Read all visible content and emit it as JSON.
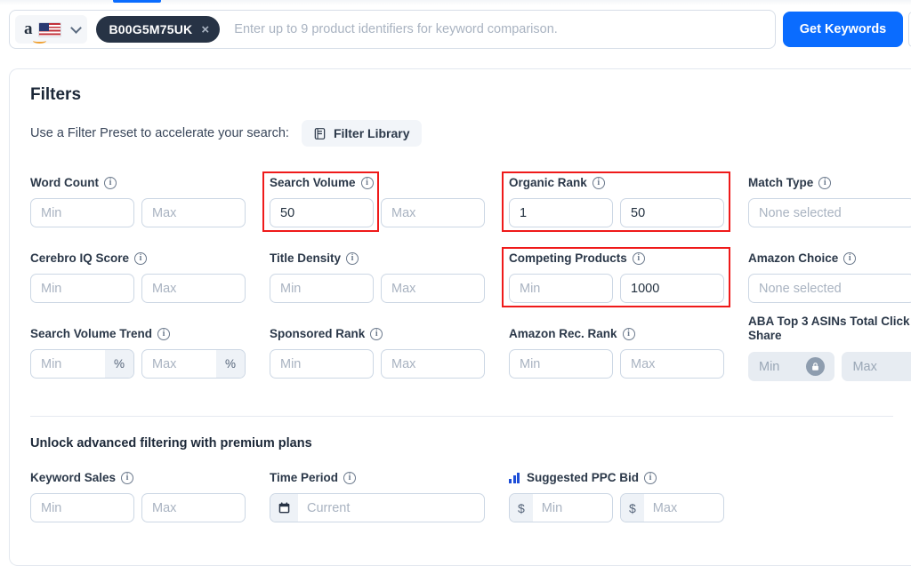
{
  "topbar": {
    "marketplace": {
      "name": "amazon-us-marketplace",
      "store_glyph": "a"
    },
    "asin_chip": {
      "label": "B00G5M75UK",
      "remove": "×"
    },
    "search_placeholder": "Enter up to 9 product identifiers for keyword comparison.",
    "search_value": "",
    "get_keywords_label": "Get Keywords"
  },
  "card": {
    "title": "Filters",
    "preset_text": "Use a Filter Preset to accelerate your search:",
    "filter_library_label": "Filter Library",
    "premium_title": "Unlock advanced filtering with premium plans"
  },
  "filters": {
    "word_count": {
      "label": "Word Count",
      "min": "",
      "max": "",
      "min_ph": "Min",
      "max_ph": "Max"
    },
    "search_volume": {
      "label": "Search Volume",
      "min": "50",
      "max": "",
      "min_ph": "Min",
      "max_ph": "Max",
      "highlighted": true
    },
    "organic_rank": {
      "label": "Organic Rank",
      "min": "1",
      "max": "50",
      "min_ph": "Min",
      "max_ph": "Max",
      "highlighted": true
    },
    "match_type": {
      "label": "Match Type",
      "value": "",
      "placeholder": "None selected"
    },
    "cerebro_iq_score": {
      "label": "Cerebro IQ Score",
      "min": "",
      "max": "",
      "min_ph": "Min",
      "max_ph": "Max"
    },
    "title_density": {
      "label": "Title Density",
      "min": "",
      "max": "",
      "min_ph": "Min",
      "max_ph": "Max"
    },
    "competing_products": {
      "label": "Competing Products",
      "min": "",
      "max": "1000",
      "min_ph": "Min",
      "max_ph": "Max",
      "highlighted": true
    },
    "amazon_choice": {
      "label": "Amazon Choice",
      "value": "",
      "placeholder": "None selected"
    },
    "search_volume_trend": {
      "label": "Search Volume Trend",
      "min": "",
      "max": "",
      "min_ph": "Min",
      "max_ph": "Max",
      "suffix": "%"
    },
    "sponsored_rank": {
      "label": "Sponsored Rank",
      "min": "",
      "max": "",
      "min_ph": "Min",
      "max_ph": "Max"
    },
    "amazon_rec_rank": {
      "label": "Amazon Rec. Rank",
      "min": "",
      "max": "",
      "min_ph": "Min",
      "max_ph": "Max"
    },
    "aba_top3_click_share": {
      "label": "ABA Top 3 ASINs Total Click Share",
      "min": "",
      "max": "",
      "min_ph": "Min",
      "max_ph": "Max",
      "locked": true
    },
    "keyword_sales": {
      "label": "Keyword Sales",
      "min": "",
      "max": "",
      "min_ph": "Min",
      "max_ph": "Max"
    },
    "time_period": {
      "label": "Time Period",
      "value": "",
      "placeholder": "Current"
    },
    "suggested_ppc_bid": {
      "label": "Suggested PPC Bid",
      "min": "",
      "max": "",
      "min_ph": "Min",
      "max_ph": "Max",
      "prefix": "$"
    }
  },
  "colors": {
    "accent_blue": "#0a6cff",
    "chip_dark": "#273345",
    "highlight_red": "#ef1a1a",
    "text_dark": "#1c2838",
    "placeholder": "#a9b3c1"
  }
}
